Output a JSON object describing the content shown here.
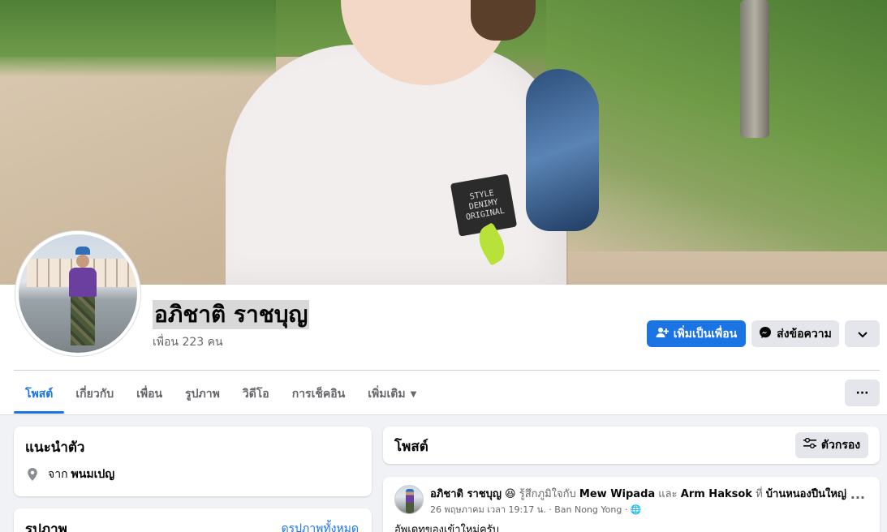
{
  "profile": {
    "name": "อภิชาติ ราชบุญ",
    "friends": "เพื่อน 223 คน"
  },
  "actions": {
    "add_friend": "เพิ่มเป็นเพื่อน",
    "message": "ส่งข้อความ",
    "more": "⌄"
  },
  "cover": {
    "shirt_print": "STYLE DENIMY ORIGINAL"
  },
  "tabs": [
    {
      "label": "โพสต์"
    },
    {
      "label": "เกี่ยวกับ"
    },
    {
      "label": "เพื่อน"
    },
    {
      "label": "รูปภาพ"
    },
    {
      "label": "วิดีโอ"
    },
    {
      "label": "การเช็คอิน"
    },
    {
      "label": "เพิ่มเติม"
    }
  ],
  "tabs_more": "···",
  "intro": {
    "title": "แนะนำตัว",
    "from_prefix": "จาก",
    "from_place": "พนมเปญ"
  },
  "photos": {
    "title": "รูปภาพ",
    "see_all": "ดูรูปภาพทั้งหมด"
  },
  "posts": {
    "title": "โพสต์",
    "filter": "ตัวกรอง"
  },
  "post": {
    "author": "อภิชาติ ราชบุญ",
    "emoji": "😆",
    "feeling": "รู้สึกภูมิใจกับ",
    "with1": "Mew Wipada",
    "and": "และ",
    "with2": "Arm Haksok",
    "at": "ที่",
    "place": "บ้านหนองปืนใหญ่",
    "meta": "26 พฤษภาคม เวลา 19:17 น. · Ban Nong Yong · ",
    "globe": "🌐",
    "more": "···",
    "text": "อัพเดทของเข้าใหม่ครับ"
  },
  "colors": {
    "accent": "#1b74e4",
    "background": "#f0f2f5",
    "button_gray": "#e4e6eb"
  }
}
